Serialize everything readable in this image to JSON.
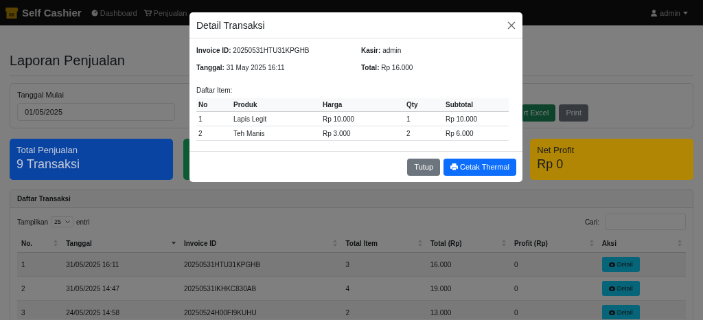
{
  "navbar": {
    "brand": "Self Cashier",
    "menu": [
      {
        "label": "Dashboard"
      },
      {
        "label": "Penjualan"
      }
    ],
    "user": "admin"
  },
  "page": {
    "title": "Laporan Penjualan",
    "filter": {
      "start_label": "Tanggal Mulai",
      "start_value": "01/05/2025",
      "buttons": [
        {
          "label": "rt Excel",
          "kind": "success"
        },
        {
          "label": "Print",
          "kind": "secondary"
        }
      ]
    },
    "cards": [
      {
        "title": "Total Penjualan",
        "value": "9 Transaksi",
        "color": "#0a44a3"
      },
      {
        "color": "#0d5a35"
      },
      {
        "title": "Net Profit",
        "value": "Rp 0",
        "color": "#b08604"
      }
    ],
    "transactions": {
      "title": "Daftar Transaksi",
      "length_before": "Tampilkan",
      "length_value": "25",
      "length_after": "entri",
      "search_label": "Cari:",
      "columns": [
        {
          "label": "No.",
          "sorted": false
        },
        {
          "label": "Tanggal",
          "sorted": true
        },
        {
          "label": "Invoice ID",
          "sorted": false
        },
        {
          "label": "Total Item",
          "sorted": false
        },
        {
          "label": "Total (Rp)",
          "sorted": false
        },
        {
          "label": "Profit (Rp)",
          "sorted": false
        },
        {
          "label": "Aksi",
          "sorted": false
        }
      ],
      "rows": [
        {
          "cells": [
            "1",
            "31/05/2025 16:11",
            "20250531HTU31KPGHB",
            "3",
            "16.000",
            "0"
          ],
          "action": "Detail"
        },
        {
          "cells": [
            "2",
            "31/05/2025 14:47",
            "20250531IKHKC830AB",
            "4",
            "19.000",
            "0"
          ],
          "action": "Detail"
        },
        {
          "cells": [
            "3",
            "24/05/2025 14:58",
            "20250524H00FI9KUHU",
            "2",
            "13.000",
            "0"
          ],
          "action": "Detail"
        }
      ]
    }
  },
  "modal": {
    "title": "Detail Transaksi",
    "fields": [
      {
        "label": "Invoice ID:",
        "value": "20250531HTU31KPGHB"
      },
      {
        "label": "Kasir:",
        "value": "admin"
      },
      {
        "label": "Tanggal:",
        "value": "31 May 2025 16:11"
      },
      {
        "label": "Total:",
        "value": "Rp 16.000"
      }
    ],
    "items_label": "Daftar Item:",
    "columns": [
      "No",
      "Produk",
      "Harga",
      "Qty",
      "Subtotal"
    ],
    "rows": [
      [
        "1",
        "Lapis Legit",
        "Rp 10.000",
        "1",
        "Rp 10.000"
      ],
      [
        "2",
        "Teh Manis",
        "Rp 3.000",
        "2",
        "Rp 6.000"
      ]
    ],
    "buttons": [
      {
        "label": "Tutup",
        "kind": "secondary"
      },
      {
        "label": "Cetak Thermal",
        "kind": "primary"
      }
    ]
  }
}
